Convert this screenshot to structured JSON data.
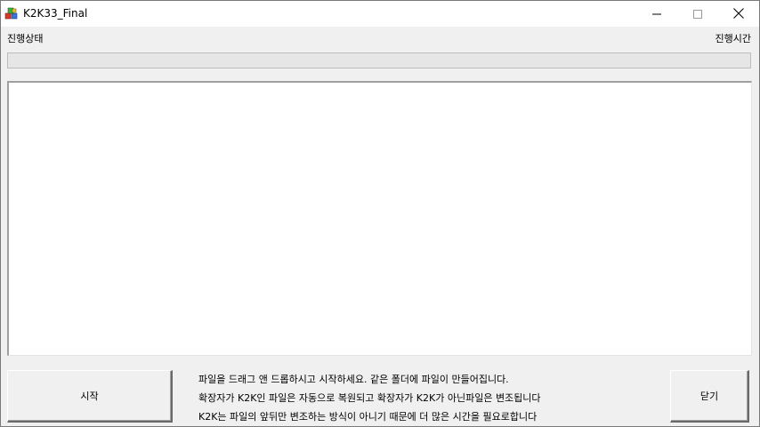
{
  "window": {
    "title": "K2K33_Final",
    "icon": "app-blocks-icon"
  },
  "caption_buttons": {
    "minimize": "minimize-icon",
    "maximize": "maximize-icon",
    "close": "close-icon"
  },
  "labels": {
    "status": "진행상태",
    "time": "진행시간"
  },
  "progress": {
    "value": 0
  },
  "log_list": {
    "items": []
  },
  "buttons": {
    "start": "시작",
    "close": "닫기"
  },
  "info": {
    "line1": "파일을 드래그 앤 드롭하시고 시작하세요. 같은 폴더에 파일이 만들어집니다.",
    "line2": "확장자가 K2K인 파일은 자동으로 복원되고 확장자가 K2K가 아닌파일은 변조됩니다",
    "line3": "K2K는 파일의 앞뒤만 변조하는 방식이 아니기 때문에 더 많은 시간을 필요로합니다"
  },
  "colors": {
    "window_bg": "#f0f0f0",
    "progress_fill": "#06b025"
  }
}
